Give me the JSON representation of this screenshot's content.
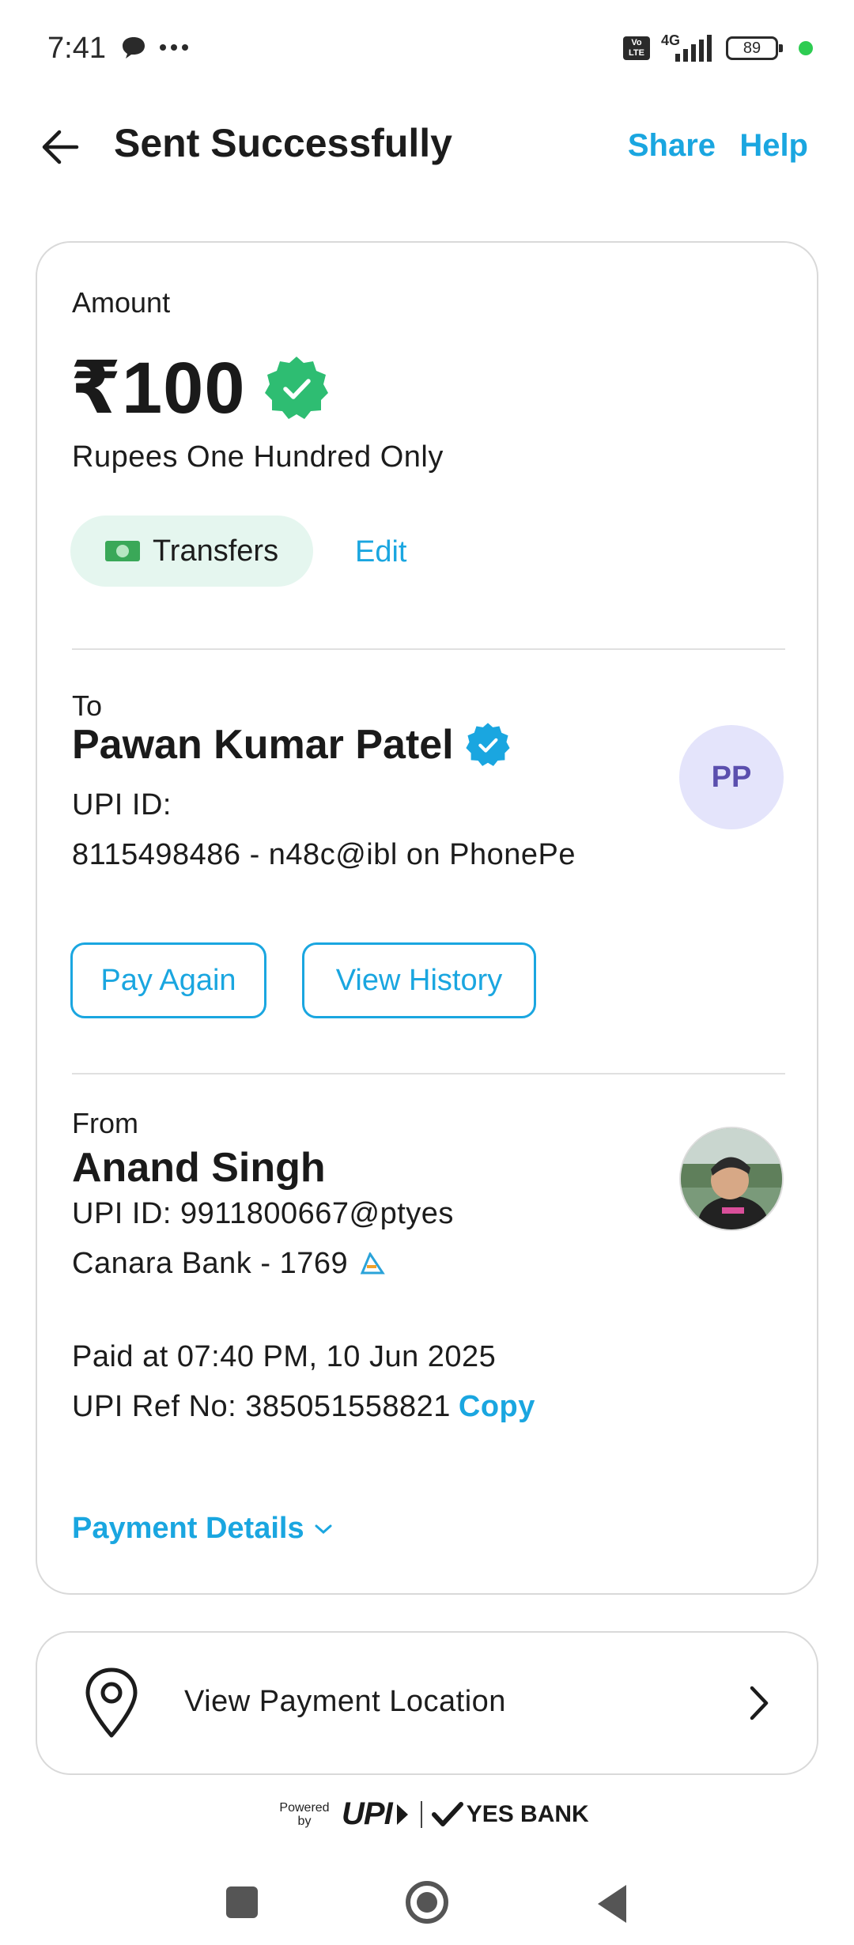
{
  "status_bar": {
    "time": "7:41",
    "network": "4G",
    "battery": "89"
  },
  "header": {
    "title": "Sent Successfully",
    "share_label": "Share",
    "help_label": "Help"
  },
  "amount_section": {
    "label": "Amount",
    "value": "₹100",
    "words": "Rupees One Hundred Only",
    "category": "Transfers",
    "edit_label": "Edit"
  },
  "to_section": {
    "label": "To",
    "name": "Pawan Kumar Patel",
    "initials": "PP",
    "upi_label": "UPI ID:",
    "upi_detail": "8115498486 - n48c@ibl on PhonePe",
    "pay_again_label": "Pay Again",
    "view_history_label": "View History"
  },
  "from_section": {
    "label": "From",
    "name": "Anand Singh",
    "upi_id": "UPI ID: 9911800667@ptyes",
    "bank": "Canara Bank - 1769",
    "paid_at": "Paid at 07:40 PM, 10 Jun 2025",
    "ref_no": "UPI Ref No: 385051558821",
    "copy_label": "Copy",
    "payment_details_label": "Payment Details"
  },
  "location": {
    "label": "View Payment Location"
  },
  "footer": {
    "powered_by": "Powered by",
    "upi": "UPI",
    "bank": "YES BANK"
  },
  "colors": {
    "accent": "#1aa6e0",
    "verified_green": "#2ebd72",
    "verified_blue": "#1aa6e0",
    "pill_bg": "#e5f6ef",
    "avatar_bg": "#e4e4fb"
  },
  "icons": [
    "back-arrow-icon",
    "verified-check-icon",
    "money-icon",
    "upi-bank-icon",
    "chevron-down-icon",
    "location-pin-icon",
    "chevron-right-icon"
  ]
}
